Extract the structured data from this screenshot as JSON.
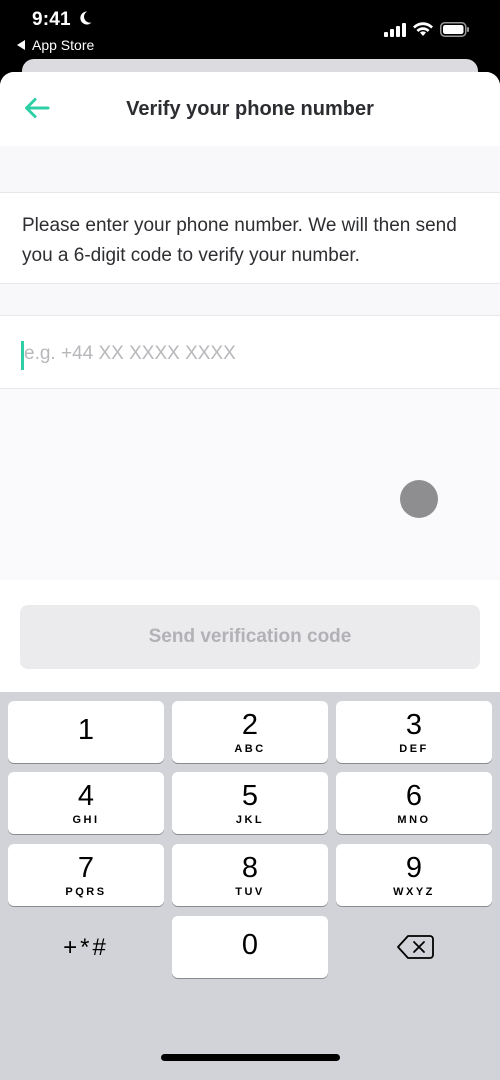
{
  "status_bar": {
    "time": "9:41",
    "back_app": "App Store",
    "icons": [
      "moon-icon",
      "cellular-signal-icon",
      "wifi-icon",
      "battery-icon"
    ]
  },
  "nav": {
    "title": "Verify your phone number",
    "back_icon": "arrow-left-icon"
  },
  "description": "Please enter your phone number. We will then send you a 6-digit code to verify your number.",
  "phone_input": {
    "value": "",
    "placeholder": "e.g. +44 XX XXXX XXXX"
  },
  "send_button": {
    "label": "Send verification code",
    "state": "disabled"
  },
  "keyboard": {
    "keys": [
      {
        "num": "1",
        "letters": ""
      },
      {
        "num": "2",
        "letters": "ABC"
      },
      {
        "num": "3",
        "letters": "DEF"
      },
      {
        "num": "4",
        "letters": "GHI"
      },
      {
        "num": "5",
        "letters": "JKL"
      },
      {
        "num": "6",
        "letters": "MNO"
      },
      {
        "num": "7",
        "letters": "PQRS"
      },
      {
        "num": "8",
        "letters": "TUV"
      },
      {
        "num": "9",
        "letters": "WXYZ"
      },
      {
        "num": "0",
        "letters": ""
      }
    ],
    "symbols_label": "+*#",
    "delete_icon": "backspace-icon"
  },
  "colors": {
    "accent": "#2fcfa6",
    "title_text": "#2c2d30",
    "button_disabled_bg": "#ebebed",
    "button_disabled_text": "#b2b2b6",
    "keyboard_bg": "#d2d3d8"
  }
}
